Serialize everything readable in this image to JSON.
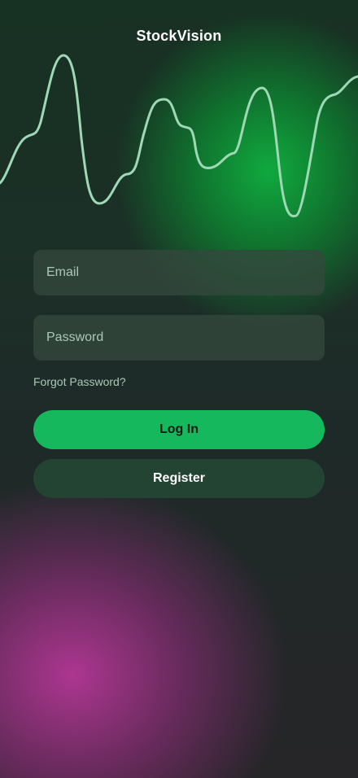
{
  "app": {
    "title": "StockVision"
  },
  "form": {
    "email_placeholder": "Email",
    "email_value": "",
    "password_placeholder": "Password",
    "password_value": "",
    "forgot_label": "Forgot Password?",
    "login_label": "Log In",
    "register_label": "Register"
  },
  "colors": {
    "accent_green": "#15b85c",
    "wave_stroke": "#9fd8b4",
    "bg_green_glow": "#10b040",
    "bg_magenta_glow": "#b4379a"
  },
  "decor": {
    "wave": "stock-trend-wave-graphic"
  }
}
